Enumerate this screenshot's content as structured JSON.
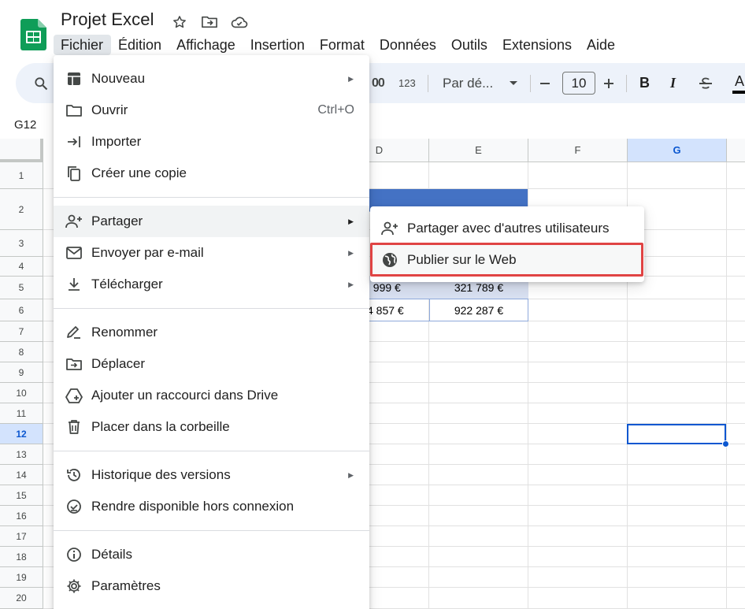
{
  "app": {
    "doc_title": "Projet Excel",
    "icons": [
      "star-icon",
      "move-to-folder-icon",
      "cloud-saved-icon"
    ]
  },
  "menubar": {
    "items": [
      "Fichier",
      "Édition",
      "Affichage",
      "Insertion",
      "Format",
      "Données",
      "Outils",
      "Extensions",
      "Aide"
    ],
    "active": "Fichier"
  },
  "toolbar": {
    "decimal_label": "00",
    "number_format_label": "123",
    "font_name": "Par dé...",
    "font_size": "10",
    "bold": "B",
    "italic": "I",
    "underline_color": "A"
  },
  "namebox": {
    "value": "G12"
  },
  "grid": {
    "columns": [
      "D",
      "E",
      "F",
      "G"
    ],
    "selected_column": "G",
    "rows": [
      "1",
      "2",
      "3",
      "4",
      "5",
      "6",
      "7",
      "8",
      "9",
      "10",
      "11",
      "12",
      "13",
      "14",
      "15",
      "16",
      "17",
      "18",
      "19",
      "20"
    ],
    "selected_row": "12",
    "cells": {
      "d5": ". 999 €",
      "e5": "321 789 €",
      "d6": "4 857 €",
      "e6": "922 287 €"
    },
    "header_fill": "#4472c4"
  },
  "file_menu": {
    "items": [
      {
        "label": "Nouveau",
        "icon": "new-sheet-icon",
        "submenu": true
      },
      {
        "label": "Ouvrir",
        "icon": "folder-icon",
        "shortcut": "Ctrl+O"
      },
      {
        "label": "Importer",
        "icon": "import-icon"
      },
      {
        "label": "Créer une copie",
        "icon": "copy-icon"
      },
      {
        "label": "Partager",
        "icon": "share-person-icon",
        "submenu": true
      },
      {
        "label": "Envoyer par e-mail",
        "icon": "mail-icon",
        "submenu": true
      },
      {
        "label": "Télécharger",
        "icon": "download-icon",
        "submenu": true
      },
      {
        "label": "Renommer",
        "icon": "rename-icon"
      },
      {
        "label": "Déplacer",
        "icon": "move-folder-icon"
      },
      {
        "label": "Ajouter un raccourci dans Drive",
        "icon": "drive-shortcut-icon"
      },
      {
        "label": "Placer dans la corbeille",
        "icon": "trash-icon"
      },
      {
        "label": "Historique des versions",
        "icon": "history-icon",
        "submenu": true
      },
      {
        "label": "Rendre disponible hors connexion",
        "icon": "offline-icon"
      },
      {
        "label": "Détails",
        "icon": "info-icon"
      },
      {
        "label": "Paramètres",
        "icon": "settings-gear-icon"
      }
    ]
  },
  "share_submenu": {
    "items": [
      {
        "label": "Partager avec d'autres utilisateurs",
        "icon": "share-person-icon"
      },
      {
        "label": "Publier sur le Web",
        "icon": "globe-icon"
      }
    ],
    "highlight_color": "#e04444"
  }
}
